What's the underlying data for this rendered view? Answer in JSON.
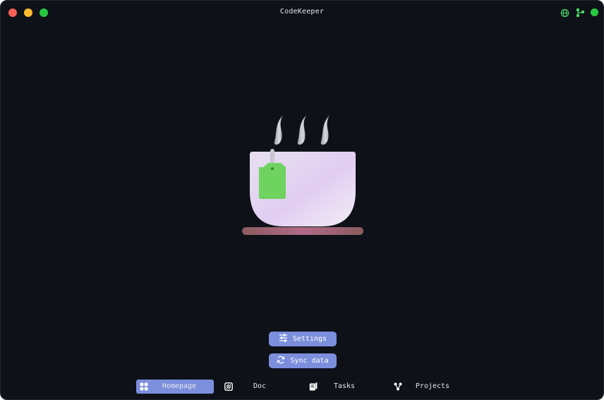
{
  "window": {
    "title": "CodeKeeper"
  },
  "titlebar": {
    "buttons": [
      "close",
      "minimize",
      "maximize"
    ],
    "right_icons": [
      "globe-icon",
      "git-branch-icon",
      "status-dot"
    ],
    "status_color": "#28c840"
  },
  "hero": {
    "icon": "teacup-icon"
  },
  "actions": {
    "settings_label": "Settings",
    "sync_label": "Sync data"
  },
  "nav": {
    "items": [
      {
        "label": "Homepage",
        "icon": "grid-icon",
        "active": true
      },
      {
        "label": "Doc",
        "icon": "doc-icon",
        "active": false
      },
      {
        "label": "Tasks",
        "icon": "tasks-icon",
        "active": false
      },
      {
        "label": "Projects",
        "icon": "projects-icon",
        "active": false
      }
    ]
  },
  "colors": {
    "background": "#0e1118",
    "accent": "#7c8fdd",
    "text": "#e6e8ec",
    "tea_tag": "#6fd35f"
  }
}
